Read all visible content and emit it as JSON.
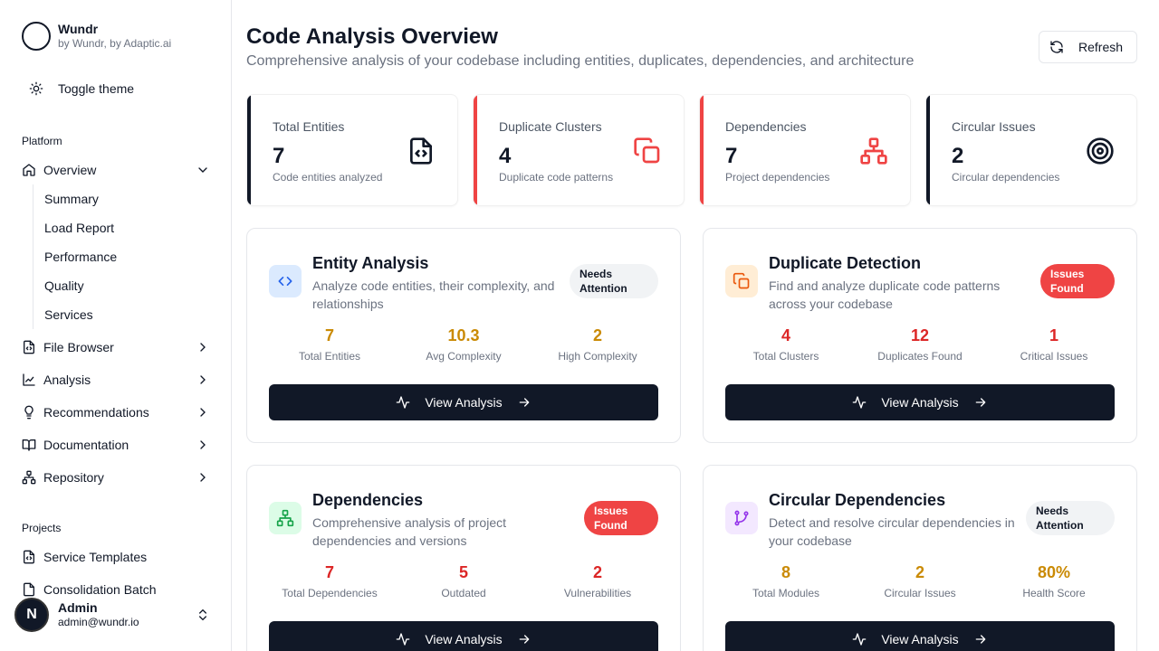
{
  "brand": {
    "name": "Wundr",
    "subtitle": "by Wundr, by Adaptic.ai"
  },
  "toggle_theme": "Toggle theme",
  "sidebar": {
    "platform_label": "Platform",
    "overview": "Overview",
    "overview_sub": [
      "Summary",
      "Load Report",
      "Performance",
      "Quality",
      "Services"
    ],
    "items": [
      {
        "label": "File Browser",
        "icon": "file-code-icon"
      },
      {
        "label": "Analysis",
        "icon": "chart-line-icon"
      },
      {
        "label": "Recommendations",
        "icon": "lightbulb-icon"
      },
      {
        "label": "Documentation",
        "icon": "book-open-icon"
      },
      {
        "label": "Repository",
        "icon": "git-network-icon"
      }
    ],
    "projects_label": "Projects",
    "projects": [
      {
        "label": "Service Templates",
        "icon": "file-code-icon"
      },
      {
        "label": "Consolidation Batch",
        "icon": "file-code-icon"
      }
    ]
  },
  "user": {
    "name": "Admin",
    "email": "admin@wundr.io",
    "initial": "N"
  },
  "page": {
    "title": "Code Analysis Overview",
    "subtitle": "Comprehensive analysis of your codebase including entities, duplicates, dependencies, and architecture",
    "refresh": "Refresh"
  },
  "stats": [
    {
      "label": "Total Entities",
      "value": "7",
      "desc": "Code entities analyzed",
      "accent": "#111827"
    },
    {
      "label": "Duplicate Clusters",
      "value": "4",
      "desc": "Duplicate code patterns",
      "accent": "#ef4444"
    },
    {
      "label": "Dependencies",
      "value": "7",
      "desc": "Project dependencies",
      "accent": "#ef4444"
    },
    {
      "label": "Circular Issues",
      "value": "2",
      "desc": "Circular dependencies",
      "accent": "#111827"
    }
  ],
  "panels": [
    {
      "title": "Entity Analysis",
      "desc": "Analyze code entities, their complexity, and relationships",
      "badge": "Needs Attention",
      "metrics": [
        {
          "value": "7",
          "label": "Total Entities"
        },
        {
          "value": "10.3",
          "label": "Avg Complexity"
        },
        {
          "value": "2",
          "label": "High Complexity"
        }
      ],
      "button": "View Analysis",
      "metric_color": "#ca8a04"
    },
    {
      "title": "Duplicate Detection",
      "desc": "Find and analyze duplicate code patterns across your codebase",
      "badge": "Issues Found",
      "metrics": [
        {
          "value": "4",
          "label": "Total Clusters"
        },
        {
          "value": "12",
          "label": "Duplicates Found"
        },
        {
          "value": "1",
          "label": "Critical Issues"
        }
      ],
      "button": "View Analysis",
      "metric_color": "#dc2626"
    },
    {
      "title": "Dependencies",
      "desc": "Comprehensive analysis of project dependencies and versions",
      "badge": "Issues Found",
      "metrics": [
        {
          "value": "7",
          "label": "Total Dependencies"
        },
        {
          "value": "5",
          "label": "Outdated"
        },
        {
          "value": "2",
          "label": "Vulnerabilities"
        }
      ],
      "button": "View Analysis",
      "metric_color": "#dc2626"
    },
    {
      "title": "Circular Dependencies",
      "desc": "Detect and resolve circular dependencies in your codebase",
      "badge": "Needs Attention",
      "metrics": [
        {
          "value": "8",
          "label": "Total Modules"
        },
        {
          "value": "2",
          "label": "Circular Issues"
        },
        {
          "value": "80%",
          "label": "Health Score"
        }
      ],
      "button": "View Analysis",
      "metric_color": "#ca8a04"
    }
  ]
}
